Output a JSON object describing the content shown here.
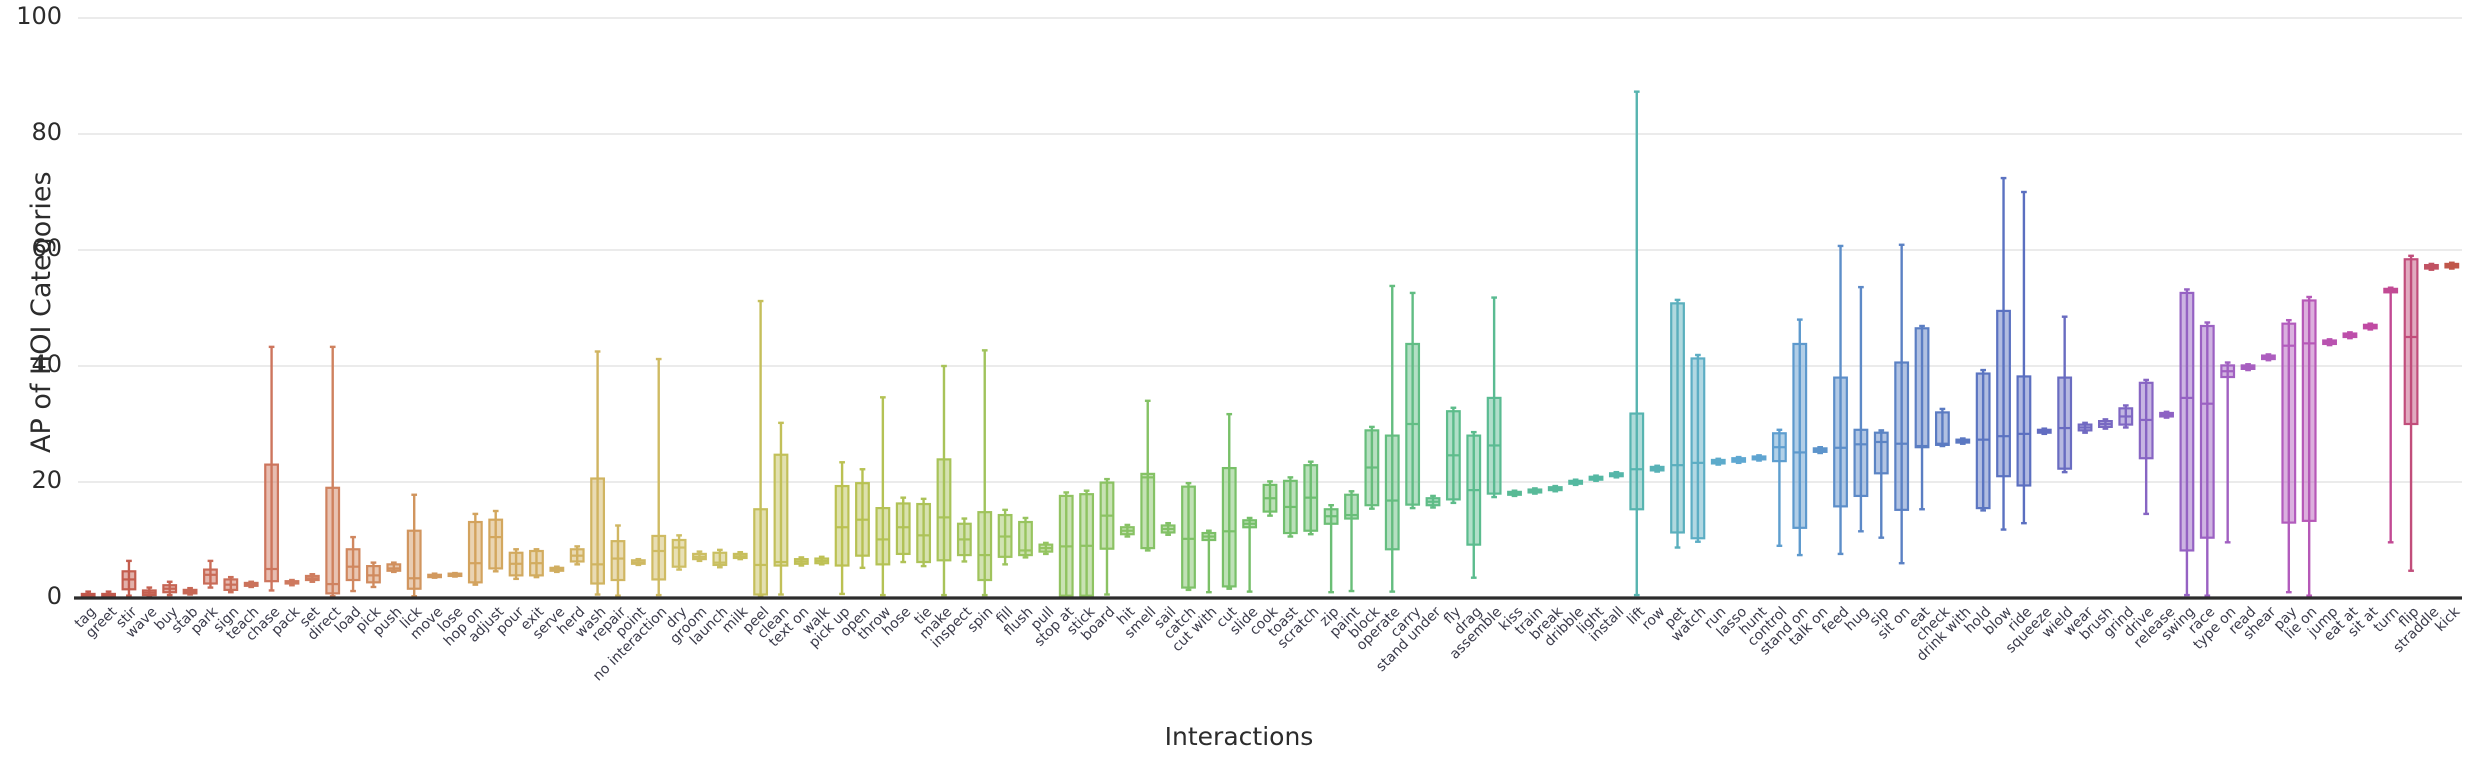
{
  "chart_data": {
    "type": "box",
    "title": "",
    "xlabel": "Interactions",
    "ylabel": "AP of HOI Categories",
    "ylim": [
      0,
      100
    ],
    "yticks": [
      0,
      20,
      40,
      60,
      80,
      100
    ],
    "grid": "horizontal",
    "legend": "none",
    "categories": [
      "tag",
      "greet",
      "stir",
      "wave",
      "buy",
      "stab",
      "park",
      "sign",
      "teach",
      "chase",
      "pack",
      "set",
      "direct",
      "load",
      "pick",
      "push",
      "lick",
      "move",
      "lose",
      "hop on",
      "adjust",
      "pour",
      "exit",
      "serve",
      "herd",
      "wash",
      "repair",
      "point",
      "no interaction",
      "dry",
      "groom",
      "launch",
      "milk",
      "peel",
      "clean",
      "text on",
      "walk",
      "pick up",
      "open",
      "throw",
      "hose",
      "tie",
      "make",
      "inspect",
      "spin",
      "fill",
      "flush",
      "pull",
      "stop at",
      "stick",
      "board",
      "hit",
      "smell",
      "sail",
      "catch",
      "cut with",
      "cut",
      "slide",
      "cook",
      "toast",
      "scratch",
      "zip",
      "paint",
      "block",
      "operate",
      "carry",
      "stand under",
      "fly",
      "drag",
      "assemble",
      "kiss",
      "train",
      "break",
      "dribble",
      "light",
      "install",
      "lift",
      "row",
      "pet",
      "watch",
      "run",
      "lasso",
      "hunt",
      "control",
      "stand on",
      "talk on",
      "feed",
      "hug",
      "sip",
      "sit on",
      "eat",
      "check",
      "drink with",
      "hold",
      "blow",
      "ride",
      "squeeze",
      "wield",
      "wear",
      "brush",
      "grind",
      "drive",
      "release",
      "swing",
      "race",
      "type on",
      "read",
      "shear",
      "pay",
      "lie on",
      "jump",
      "eat at",
      "sit at",
      "turn",
      "flip",
      "straddle",
      "kick"
    ],
    "boxes": [
      {
        "c": "tag",
        "q1": 0.2,
        "med": 0.4,
        "q3": 0.7,
        "lo": 0.0,
        "hi": 1.1
      },
      {
        "c": "greet",
        "q1": 0.2,
        "med": 0.4,
        "q3": 0.7,
        "lo": 0.0,
        "hi": 1.1
      },
      {
        "c": "stir",
        "q1": 1.5,
        "med": 3.2,
        "q3": 4.6,
        "lo": 0.4,
        "hi": 6.4
      },
      {
        "c": "wave",
        "q1": 0.5,
        "med": 0.9,
        "q3": 1.3,
        "lo": 0.2,
        "hi": 1.8
      },
      {
        "c": "buy",
        "q1": 1.0,
        "med": 1.6,
        "q3": 2.2,
        "lo": 0.5,
        "hi": 2.8
      },
      {
        "c": "stab",
        "q1": 0.8,
        "med": 1.1,
        "q3": 1.4,
        "lo": 0.6,
        "hi": 1.7
      },
      {
        "c": "park",
        "q1": 2.5,
        "med": 4.0,
        "q3": 4.9,
        "lo": 1.8,
        "hi": 6.4
      },
      {
        "c": "sign",
        "q1": 1.4,
        "med": 2.3,
        "q3": 3.2,
        "lo": 1.0,
        "hi": 3.6
      },
      {
        "c": "teach",
        "q1": 2.1,
        "med": 2.3,
        "q3": 2.6,
        "lo": 1.9,
        "hi": 2.8
      },
      {
        "c": "chase",
        "q1": 2.9,
        "med": 5.0,
        "q3": 23.0,
        "lo": 1.3,
        "hi": 43.3
      },
      {
        "c": "pack",
        "q1": 2.5,
        "med": 2.7,
        "q3": 2.9,
        "lo": 2.2,
        "hi": 3.1
      },
      {
        "c": "set",
        "q1": 3.1,
        "med": 3.4,
        "q3": 3.8,
        "lo": 2.8,
        "hi": 4.1
      },
      {
        "c": "direct",
        "q1": 0.8,
        "med": 2.4,
        "q3": 19.0,
        "lo": 0.3,
        "hi": 43.3
      },
      {
        "c": "load",
        "q1": 3.1,
        "med": 5.4,
        "q3": 8.4,
        "lo": 1.2,
        "hi": 10.5
      },
      {
        "c": "pick",
        "q1": 2.7,
        "med": 3.9,
        "q3": 5.5,
        "lo": 1.9,
        "hi": 6.1
      },
      {
        "c": "push",
        "q1": 4.7,
        "med": 5.1,
        "q3": 5.8,
        "lo": 4.5,
        "hi": 6.1
      },
      {
        "c": "lick",
        "q1": 1.6,
        "med": 3.4,
        "q3": 11.6,
        "lo": 0.3,
        "hi": 17.8
      },
      {
        "c": "move",
        "q1": 3.6,
        "med": 3.8,
        "q3": 4.0,
        "lo": 3.5,
        "hi": 4.2
      },
      {
        "c": "lose",
        "q1": 3.8,
        "med": 4.0,
        "q3": 4.2,
        "lo": 3.7,
        "hi": 4.3
      },
      {
        "c": "hop on",
        "q1": 2.7,
        "med": 6.0,
        "q3": 13.1,
        "lo": 2.3,
        "hi": 14.5
      },
      {
        "c": "adjust",
        "q1": 5.1,
        "med": 10.5,
        "q3": 13.5,
        "lo": 4.6,
        "hi": 15.0
      },
      {
        "c": "pour",
        "q1": 3.9,
        "med": 5.9,
        "q3": 7.8,
        "lo": 3.3,
        "hi": 8.4
      },
      {
        "c": "exit",
        "q1": 3.9,
        "med": 6.0,
        "q3": 8.1,
        "lo": 3.6,
        "hi": 8.4
      },
      {
        "c": "serve",
        "q1": 4.7,
        "med": 4.9,
        "q3": 5.2,
        "lo": 4.5,
        "hi": 5.4
      },
      {
        "c": "herd",
        "q1": 6.3,
        "med": 7.3,
        "q3": 8.4,
        "lo": 5.8,
        "hi": 8.9
      },
      {
        "c": "wash",
        "q1": 2.5,
        "med": 5.8,
        "q3": 20.6,
        "lo": 0.6,
        "hi": 42.5
      },
      {
        "c": "repair",
        "q1": 3.1,
        "med": 6.8,
        "q3": 9.8,
        "lo": 0.4,
        "hi": 12.5
      },
      {
        "c": "point",
        "q1": 5.9,
        "med": 6.1,
        "q3": 6.5,
        "lo": 5.7,
        "hi": 6.7
      },
      {
        "c": "no interaction",
        "q1": 3.2,
        "med": 8.1,
        "q3": 10.7,
        "lo": 0.5,
        "hi": 41.2
      },
      {
        "c": "dry",
        "q1": 5.4,
        "med": 8.7,
        "q3": 10.0,
        "lo": 4.9,
        "hi": 10.8
      },
      {
        "c": "groom",
        "q1": 6.7,
        "med": 7.1,
        "q3": 7.6,
        "lo": 6.4,
        "hi": 8.0
      },
      {
        "c": "launch",
        "q1": 5.7,
        "med": 6.1,
        "q3": 7.8,
        "lo": 5.3,
        "hi": 8.3
      },
      {
        "c": "milk",
        "q1": 6.9,
        "med": 7.2,
        "q3": 7.6,
        "lo": 6.7,
        "hi": 7.9
      },
      {
        "c": "peel",
        "q1": 0.6,
        "med": 5.7,
        "q3": 15.3,
        "lo": 0.3,
        "hi": 51.2
      },
      {
        "c": "clean",
        "q1": 5.6,
        "med": 6.2,
        "q3": 24.7,
        "lo": 0.6,
        "hi": 30.2
      },
      {
        "c": "text on",
        "q1": 5.9,
        "med": 6.3,
        "q3": 6.7,
        "lo": 5.6,
        "hi": 7.0
      },
      {
        "c": "walk",
        "q1": 6.0,
        "med": 6.4,
        "q3": 6.8,
        "lo": 5.8,
        "hi": 7.1
      },
      {
        "c": "pick up",
        "q1": 5.6,
        "med": 12.2,
        "q3": 19.3,
        "lo": 0.7,
        "hi": 23.4
      },
      {
        "c": "open",
        "q1": 7.3,
        "med": 13.5,
        "q3": 19.8,
        "lo": 5.2,
        "hi": 22.2
      },
      {
        "c": "throw",
        "q1": 5.8,
        "med": 10.1,
        "q3": 15.5,
        "lo": 0.5,
        "hi": 34.6
      },
      {
        "c": "hose",
        "q1": 7.6,
        "med": 12.2,
        "q3": 16.3,
        "lo": 6.2,
        "hi": 17.3
      },
      {
        "c": "tie",
        "q1": 6.2,
        "med": 10.8,
        "q3": 16.2,
        "lo": 5.5,
        "hi": 17.1
      },
      {
        "c": "make",
        "q1": 6.5,
        "med": 13.9,
        "q3": 23.9,
        "lo": 0.5,
        "hi": 40.0
      },
      {
        "c": "inspect",
        "q1": 7.4,
        "med": 10.1,
        "q3": 12.8,
        "lo": 6.3,
        "hi": 13.7
      },
      {
        "c": "spin",
        "q1": 3.1,
        "med": 7.4,
        "q3": 14.8,
        "lo": 0.5,
        "hi": 42.7
      },
      {
        "c": "fill",
        "q1": 7.1,
        "med": 10.6,
        "q3": 14.3,
        "lo": 5.8,
        "hi": 15.2
      },
      {
        "c": "flush",
        "q1": 7.4,
        "med": 8.2,
        "q3": 13.1,
        "lo": 7.0,
        "hi": 13.8
      },
      {
        "c": "pull",
        "q1": 8.0,
        "med": 8.6,
        "q3": 9.2,
        "lo": 7.6,
        "hi": 9.5
      },
      {
        "c": "stop at",
        "q1": 0.4,
        "med": 8.9,
        "q3": 17.6,
        "lo": 0.2,
        "hi": 18.2
      },
      {
        "c": "stick",
        "q1": 0.4,
        "med": 9.0,
        "q3": 17.9,
        "lo": 0.2,
        "hi": 18.5
      },
      {
        "c": "board",
        "q1": 8.5,
        "med": 14.2,
        "q3": 19.9,
        "lo": 0.6,
        "hi": 20.5
      },
      {
        "c": "hit",
        "q1": 11.0,
        "med": 11.6,
        "q3": 12.2,
        "lo": 10.6,
        "hi": 12.6
      },
      {
        "c": "smell",
        "q1": 8.6,
        "med": 20.8,
        "q3": 21.4,
        "lo": 8.2,
        "hi": 34.0
      },
      {
        "c": "sail",
        "q1": 11.3,
        "med": 11.9,
        "q3": 12.5,
        "lo": 10.9,
        "hi": 12.9
      },
      {
        "c": "catch",
        "q1": 1.8,
        "med": 10.2,
        "q3": 19.2,
        "lo": 1.4,
        "hi": 19.8
      },
      {
        "c": "cut with",
        "q1": 10.0,
        "med": 10.6,
        "q3": 11.2,
        "lo": 1.0,
        "hi": 11.6
      },
      {
        "c": "cut",
        "q1": 2.0,
        "med": 11.5,
        "q3": 22.4,
        "lo": 1.6,
        "hi": 31.7
      },
      {
        "c": "slide",
        "q1": 12.2,
        "med": 12.8,
        "q3": 13.4,
        "lo": 1.1,
        "hi": 13.8
      },
      {
        "c": "cook",
        "q1": 14.9,
        "med": 17.2,
        "q3": 19.5,
        "lo": 14.2,
        "hi": 20.1
      },
      {
        "c": "toast",
        "q1": 11.2,
        "med": 15.7,
        "q3": 20.2,
        "lo": 10.6,
        "hi": 20.8
      },
      {
        "c": "scratch",
        "q1": 11.6,
        "med": 17.3,
        "q3": 22.9,
        "lo": 11.0,
        "hi": 23.5
      },
      {
        "c": "zip",
        "q1": 12.8,
        "med": 14.1,
        "q3": 15.3,
        "lo": 1.0,
        "hi": 16.0
      },
      {
        "c": "paint",
        "q1": 13.7,
        "med": 14.3,
        "q3": 17.8,
        "lo": 1.2,
        "hi": 18.4
      },
      {
        "c": "block",
        "q1": 16.0,
        "med": 22.5,
        "q3": 28.9,
        "lo": 15.4,
        "hi": 29.5
      },
      {
        "c": "operate",
        "q1": 8.4,
        "med": 16.8,
        "q3": 28.0,
        "lo": 1.1,
        "hi": 53.8
      },
      {
        "c": "carry",
        "q1": 16.1,
        "med": 30.0,
        "q3": 43.8,
        "lo": 15.5,
        "hi": 52.6
      },
      {
        "c": "stand under",
        "q1": 16.0,
        "med": 16.6,
        "q3": 17.2,
        "lo": 15.6,
        "hi": 17.6
      },
      {
        "c": "fly",
        "q1": 17.0,
        "med": 24.6,
        "q3": 32.2,
        "lo": 16.4,
        "hi": 32.8
      },
      {
        "c": "drag",
        "q1": 9.2,
        "med": 18.6,
        "q3": 28.0,
        "lo": 3.5,
        "hi": 28.6
      },
      {
        "c": "assemble",
        "q1": 18.0,
        "med": 26.3,
        "q3": 34.5,
        "lo": 17.4,
        "hi": 51.8
      },
      {
        "c": "kiss",
        "q1": 17.8,
        "med": 18.0,
        "q3": 18.3,
        "lo": 17.6,
        "hi": 18.5
      },
      {
        "c": "train",
        "q1": 18.2,
        "med": 18.4,
        "q3": 18.7,
        "lo": 18.0,
        "hi": 18.9
      },
      {
        "c": "break",
        "q1": 18.6,
        "med": 18.9,
        "q3": 19.1,
        "lo": 18.4,
        "hi": 19.3
      },
      {
        "c": "dribble",
        "q1": 19.7,
        "med": 19.9,
        "q3": 20.2,
        "lo": 19.5,
        "hi": 20.4
      },
      {
        "c": "light",
        "q1": 20.4,
        "med": 20.6,
        "q3": 20.9,
        "lo": 20.2,
        "hi": 21.1
      },
      {
        "c": "install",
        "q1": 21.0,
        "med": 21.2,
        "q3": 21.5,
        "lo": 20.8,
        "hi": 21.7
      },
      {
        "c": "lift",
        "q1": 15.3,
        "med": 22.2,
        "q3": 31.8,
        "lo": 0.5,
        "hi": 87.3
      },
      {
        "c": "row",
        "q1": 22.0,
        "med": 22.3,
        "q3": 22.6,
        "lo": 21.8,
        "hi": 22.8
      },
      {
        "c": "pet",
        "q1": 11.3,
        "med": 22.9,
        "q3": 50.8,
        "lo": 8.7,
        "hi": 51.4
      },
      {
        "c": "watch",
        "q1": 10.3,
        "med": 23.3,
        "q3": 41.3,
        "lo": 9.7,
        "hi": 41.9
      },
      {
        "c": "run",
        "q1": 23.2,
        "med": 23.5,
        "q3": 23.8,
        "lo": 23.0,
        "hi": 24.0
      },
      {
        "c": "lasso",
        "q1": 23.5,
        "med": 23.8,
        "q3": 24.1,
        "lo": 23.3,
        "hi": 24.3
      },
      {
        "c": "hunt",
        "q1": 23.9,
        "med": 24.1,
        "q3": 24.4,
        "lo": 23.7,
        "hi": 24.6
      },
      {
        "c": "control",
        "q1": 23.6,
        "med": 26.0,
        "q3": 28.4,
        "lo": 9.0,
        "hi": 29.0
      },
      {
        "c": "stand on",
        "q1": 12.1,
        "med": 25.1,
        "q3": 43.8,
        "lo": 7.4,
        "hi": 48.0
      },
      {
        "c": "talk on",
        "q1": 25.2,
        "med": 25.5,
        "q3": 25.8,
        "lo": 25.0,
        "hi": 26.0
      },
      {
        "c": "feed",
        "q1": 15.8,
        "med": 25.9,
        "q3": 38.0,
        "lo": 7.6,
        "hi": 60.7
      },
      {
        "c": "hug",
        "q1": 17.6,
        "med": 26.5,
        "q3": 29.0,
        "lo": 11.5,
        "hi": 53.6
      },
      {
        "c": "sip",
        "q1": 21.5,
        "med": 26.9,
        "q3": 28.5,
        "lo": 10.4,
        "hi": 28.9
      },
      {
        "c": "sit on",
        "q1": 15.2,
        "med": 26.6,
        "q3": 40.6,
        "lo": 6.0,
        "hi": 60.9
      },
      {
        "c": "eat",
        "q1": 26.0,
        "med": 26.2,
        "q3": 46.5,
        "lo": 15.3,
        "hi": 46.9
      },
      {
        "c": "check",
        "q1": 26.4,
        "med": 26.6,
        "q3": 32.0,
        "lo": 26.2,
        "hi": 32.6
      },
      {
        "c": "drink with",
        "q1": 26.8,
        "med": 27.0,
        "q3": 27.3,
        "lo": 26.6,
        "hi": 27.5
      },
      {
        "c": "hold",
        "q1": 15.5,
        "med": 27.3,
        "q3": 38.7,
        "lo": 15.1,
        "hi": 39.3
      },
      {
        "c": "blow",
        "q1": 21.0,
        "med": 27.9,
        "q3": 49.5,
        "lo": 11.8,
        "hi": 72.4
      },
      {
        "c": "ride",
        "q1": 19.4,
        "med": 28.3,
        "q3": 38.2,
        "lo": 12.9,
        "hi": 70.0
      },
      {
        "c": "squeeze",
        "q1": 28.5,
        "med": 28.8,
        "q3": 29.0,
        "lo": 28.3,
        "hi": 29.2
      },
      {
        "c": "wield",
        "q1": 22.3,
        "med": 29.3,
        "q3": 38.0,
        "lo": 21.7,
        "hi": 48.5
      },
      {
        "c": "wear",
        "q1": 28.9,
        "med": 29.4,
        "q3": 29.9,
        "lo": 28.5,
        "hi": 30.2
      },
      {
        "c": "brush",
        "q1": 29.5,
        "med": 30.0,
        "q3": 30.5,
        "lo": 29.2,
        "hi": 30.8
      },
      {
        "c": "grind",
        "q1": 29.9,
        "med": 31.3,
        "q3": 32.7,
        "lo": 29.4,
        "hi": 33.2
      },
      {
        "c": "drive",
        "q1": 24.1,
        "med": 30.7,
        "q3": 37.1,
        "lo": 14.5,
        "hi": 37.6
      },
      {
        "c": "release",
        "q1": 31.3,
        "med": 31.6,
        "q3": 31.9,
        "lo": 31.1,
        "hi": 32.1
      },
      {
        "c": "swing",
        "q1": 8.2,
        "med": 34.5,
        "q3": 52.6,
        "lo": 0.5,
        "hi": 53.2
      },
      {
        "c": "race",
        "q1": 10.4,
        "med": 33.5,
        "q3": 46.9,
        "lo": 0.4,
        "hi": 47.5
      },
      {
        "c": "type on",
        "q1": 38.1,
        "med": 39.1,
        "q3": 40.1,
        "lo": 9.6,
        "hi": 40.6
      },
      {
        "c": "read",
        "q1": 39.5,
        "med": 39.8,
        "q3": 40.1,
        "lo": 39.3,
        "hi": 40.3
      },
      {
        "c": "shear",
        "q1": 41.2,
        "med": 41.5,
        "q3": 41.8,
        "lo": 41.0,
        "hi": 42.0
      },
      {
        "c": "pay",
        "q1": 13.0,
        "med": 43.5,
        "q3": 47.3,
        "lo": 1.0,
        "hi": 47.9
      },
      {
        "c": "lie on",
        "q1": 13.3,
        "med": 43.9,
        "q3": 51.3,
        "lo": 0.4,
        "hi": 51.9
      },
      {
        "c": "jump",
        "q1": 43.8,
        "med": 44.1,
        "q3": 44.4,
        "lo": 43.6,
        "hi": 44.6
      },
      {
        "c": "eat at",
        "q1": 45.0,
        "med": 45.3,
        "q3": 45.6,
        "lo": 44.8,
        "hi": 45.8
      },
      {
        "c": "sit at",
        "q1": 46.5,
        "med": 46.8,
        "q3": 47.1,
        "lo": 46.3,
        "hi": 47.3
      },
      {
        "c": "turn",
        "q1": 52.7,
        "med": 53.0,
        "q3": 53.3,
        "lo": 9.6,
        "hi": 53.5
      },
      {
        "c": "flip",
        "q1": 30.0,
        "med": 45.0,
        "q3": 58.4,
        "lo": 4.7,
        "hi": 59.0
      },
      {
        "c": "straddle",
        "q1": 56.8,
        "med": 57.1,
        "q3": 57.4,
        "lo": 56.6,
        "hi": 57.6
      },
      {
        "c": "kick",
        "q1": 57.0,
        "med": 57.3,
        "q3": 57.6,
        "lo": 56.8,
        "hi": 57.8
      }
    ],
    "palette_note": "Spectral-like gradient: red-orange → tan → olive → green → teal → blue → purple → magenta → red",
    "colors": {
      "axis": "#2c2c2c",
      "grid": "#ebebeb",
      "background": "#ffffff",
      "start": "#c0564a",
      "tan": "#d3a65e",
      "olive": "#c2c04f",
      "green": "#72bf6a",
      "teal": "#54b8a4",
      "blue": "#5fa8d3",
      "indigo": "#5b6fc0",
      "purple": "#8f63c4",
      "magenta": "#c248a0",
      "end": "#c0564a"
    }
  },
  "axes": {
    "ylabel": "AP of HOI Categories",
    "xlabel": "Interactions",
    "ytick_labels": [
      "0",
      "20",
      "40",
      "60",
      "80",
      "100"
    ]
  }
}
